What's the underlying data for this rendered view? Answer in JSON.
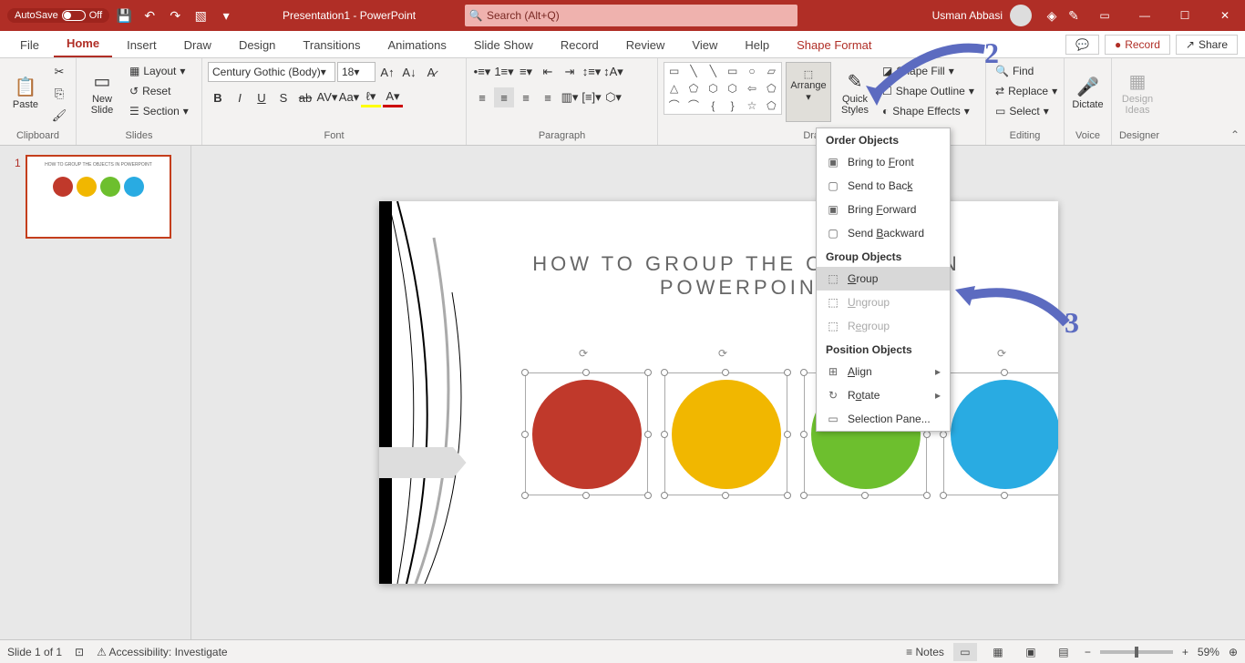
{
  "titlebar": {
    "autosave": "AutoSave",
    "autosave_state": "Off",
    "doc_title": "Presentation1 - PowerPoint",
    "search_placeholder": "Search (Alt+Q)",
    "user": "Usman Abbasi"
  },
  "tabs": {
    "file": "File",
    "home": "Home",
    "insert": "Insert",
    "draw": "Draw",
    "design": "Design",
    "transitions": "Transitions",
    "animations": "Animations",
    "slideshow": "Slide Show",
    "record_tab": "Record",
    "review": "Review",
    "view": "View",
    "help": "Help",
    "shape_format": "Shape Format",
    "comments": "",
    "record_btn": "Record",
    "share": "Share"
  },
  "ribbon": {
    "clipboard": {
      "label": "Clipboard",
      "paste": "Paste"
    },
    "slides": {
      "label": "Slides",
      "new_slide": "New\nSlide",
      "layout": "Layout",
      "reset": "Reset",
      "section": "Section"
    },
    "font": {
      "label": "Font",
      "name": "Century Gothic (Body)",
      "size": "18"
    },
    "paragraph": {
      "label": "Paragraph"
    },
    "drawing": {
      "label": "Drawing",
      "arrange": "Arrange",
      "quick_styles": "Quick\nStyles",
      "shape_fill": "Shape Fill",
      "shape_outline": "Shape Outline",
      "shape_effects": "Shape Effects"
    },
    "editing": {
      "label": "Editing",
      "find": "Find",
      "replace": "Replace",
      "select": "Select"
    },
    "voice": {
      "label": "Voice",
      "dictate": "Dictate"
    },
    "designer": {
      "label": "Designer",
      "design_ideas": "Design\nIdeas"
    }
  },
  "dropdown": {
    "order_hdr": "Order Objects",
    "bring_front": "Bring to Front",
    "send_back": "Send to Back",
    "bring_fwd": "Bring Forward",
    "send_bwd": "Send Backward",
    "group_hdr": "Group Objects",
    "group": "Group",
    "ungroup": "Ungroup",
    "regroup": "Regroup",
    "position_hdr": "Position Objects",
    "align": "Align",
    "rotate": "Rotate",
    "selection_pane": "Selection Pane..."
  },
  "slide": {
    "title": "HOW TO GROUP THE  OBJECTS  IN POWERPOINT",
    "circles": [
      "#c0392b",
      "#f1b700",
      "#6dbf2e",
      "#29abe2"
    ]
  },
  "thumb": {
    "num": "1",
    "title": "HOW TO GROUP THE  OBJECTS  IN POWERPOINT"
  },
  "annotations": {
    "two": "2",
    "three": "3"
  },
  "status": {
    "slide": "Slide 1 of 1",
    "access": "Accessibility: Investigate",
    "notes": "Notes",
    "zoom": "59%"
  }
}
